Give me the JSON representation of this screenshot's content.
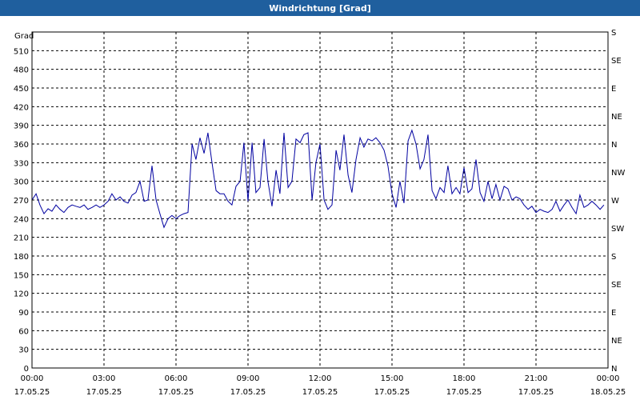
{
  "window": {
    "title": "Windrichtung [Grad]"
  },
  "chart_data": {
    "type": "line",
    "title": "Windrichtung [Grad]",
    "ylabel": "Grad",
    "xlabel": "",
    "ylim": [
      0,
      540
    ],
    "xlim": [
      "17.05.25 00:00",
      "18.05.25 00:00"
    ],
    "grid": true,
    "y_ticks": [
      0,
      30,
      60,
      90,
      120,
      150,
      180,
      210,
      240,
      270,
      300,
      330,
      360,
      390,
      420,
      450,
      480,
      510
    ],
    "y_right_ticks": [
      {
        "value": 0,
        "label": "N"
      },
      {
        "value": 45,
        "label": "NE"
      },
      {
        "value": 90,
        "label": "E"
      },
      {
        "value": 135,
        "label": "SE"
      },
      {
        "value": 180,
        "label": "S"
      },
      {
        "value": 225,
        "label": "SW"
      },
      {
        "value": 270,
        "label": "W"
      },
      {
        "value": 315,
        "label": "NW"
      },
      {
        "value": 360,
        "label": "N"
      },
      {
        "value": 405,
        "label": "NE"
      },
      {
        "value": 450,
        "label": "E"
      },
      {
        "value": 495,
        "label": "SE"
      },
      {
        "value": 540,
        "label": "S"
      }
    ],
    "x_ticks": [
      {
        "hour": 0,
        "time": "00:00",
        "date": "17.05.25"
      },
      {
        "hour": 3,
        "time": "03:00",
        "date": "17.05.25"
      },
      {
        "hour": 6,
        "time": "06:00",
        "date": "17.05.25"
      },
      {
        "hour": 9,
        "time": "09:00",
        "date": "17.05.25"
      },
      {
        "hour": 12,
        "time": "12:00",
        "date": "17.05.25"
      },
      {
        "hour": 15,
        "time": "15:00",
        "date": "17.05.25"
      },
      {
        "hour": 18,
        "time": "18:00",
        "date": "17.05.25"
      },
      {
        "hour": 21,
        "time": "21:00",
        "date": "17.05.25"
      },
      {
        "hour": 24,
        "time": "00:00",
        "date": "18.05.25"
      }
    ],
    "series": [
      {
        "color": "#0000a0",
        "x": [
          0.0,
          0.17,
          0.33,
          0.5,
          0.67,
          0.83,
          1.0,
          1.17,
          1.33,
          1.5,
          1.67,
          1.83,
          2.0,
          2.17,
          2.33,
          2.5,
          2.67,
          2.83,
          3.0,
          3.17,
          3.33,
          3.5,
          3.67,
          3.83,
          4.0,
          4.17,
          4.33,
          4.5,
          4.67,
          4.83,
          5.0,
          5.17,
          5.33,
          5.5,
          5.67,
          5.83,
          6.0,
          6.17,
          6.33,
          6.5,
          6.67,
          6.83,
          7.0,
          7.17,
          7.33,
          7.5,
          7.67,
          7.83,
          8.0,
          8.17,
          8.33,
          8.5,
          8.67,
          8.83,
          9.0,
          9.17,
          9.33,
          9.5,
          9.67,
          9.83,
          10.0,
          10.17,
          10.33,
          10.5,
          10.67,
          10.83,
          11.0,
          11.17,
          11.33,
          11.5,
          11.67,
          11.83,
          12.0,
          12.17,
          12.33,
          12.5,
          12.67,
          12.83,
          13.0,
          13.17,
          13.33,
          13.5,
          13.67,
          13.83,
          14.0,
          14.17,
          14.33,
          14.5,
          14.67,
          14.83,
          15.0,
          15.17,
          15.33,
          15.5,
          15.67,
          15.83,
          16.0,
          16.17,
          16.33,
          16.5,
          16.67,
          16.83,
          17.0,
          17.17,
          17.33,
          17.5,
          17.67,
          17.83,
          18.0,
          18.17,
          18.33,
          18.5,
          18.67,
          18.83,
          19.0,
          19.17,
          19.33,
          19.5,
          19.67,
          19.83,
          20.0,
          20.17,
          20.33,
          20.5,
          20.67,
          20.83,
          21.0,
          21.17,
          21.33,
          21.5,
          21.67,
          21.83,
          22.0,
          22.17,
          22.33,
          22.5,
          22.67,
          22.83,
          23.0,
          23.17,
          23.33,
          23.5,
          23.67,
          23.83
        ],
        "y": [
          270,
          280,
          262,
          248,
          256,
          252,
          262,
          255,
          250,
          258,
          262,
          260,
          258,
          262,
          255,
          258,
          262,
          258,
          262,
          268,
          280,
          270,
          275,
          268,
          265,
          278,
          282,
          300,
          268,
          270,
          325,
          270,
          248,
          226,
          240,
          245,
          240,
          245,
          248,
          250,
          360,
          335,
          370,
          345,
          378,
          330,
          285,
          280,
          280,
          268,
          262,
          292,
          300,
          362,
          268,
          362,
          282,
          290,
          368,
          300,
          260,
          318,
          280,
          378,
          290,
          300,
          368,
          362,
          375,
          378,
          270,
          330,
          360,
          270,
          255,
          262,
          350,
          318,
          375,
          310,
          282,
          335,
          370,
          355,
          368,
          365,
          370,
          362,
          350,
          325,
          280,
          258,
          300,
          265,
          365,
          382,
          360,
          320,
          335,
          375,
          285,
          272,
          290,
          282,
          325,
          280,
          290,
          280,
          322,
          282,
          288,
          335,
          282,
          268,
          300,
          272,
          295,
          270,
          292,
          288,
          270,
          275,
          272,
          262,
          255,
          260,
          250,
          255,
          252,
          250,
          255,
          268,
          252,
          262,
          270,
          258,
          248,
          278,
          258,
          262,
          268,
          262,
          255,
          262
        ]
      }
    ]
  }
}
